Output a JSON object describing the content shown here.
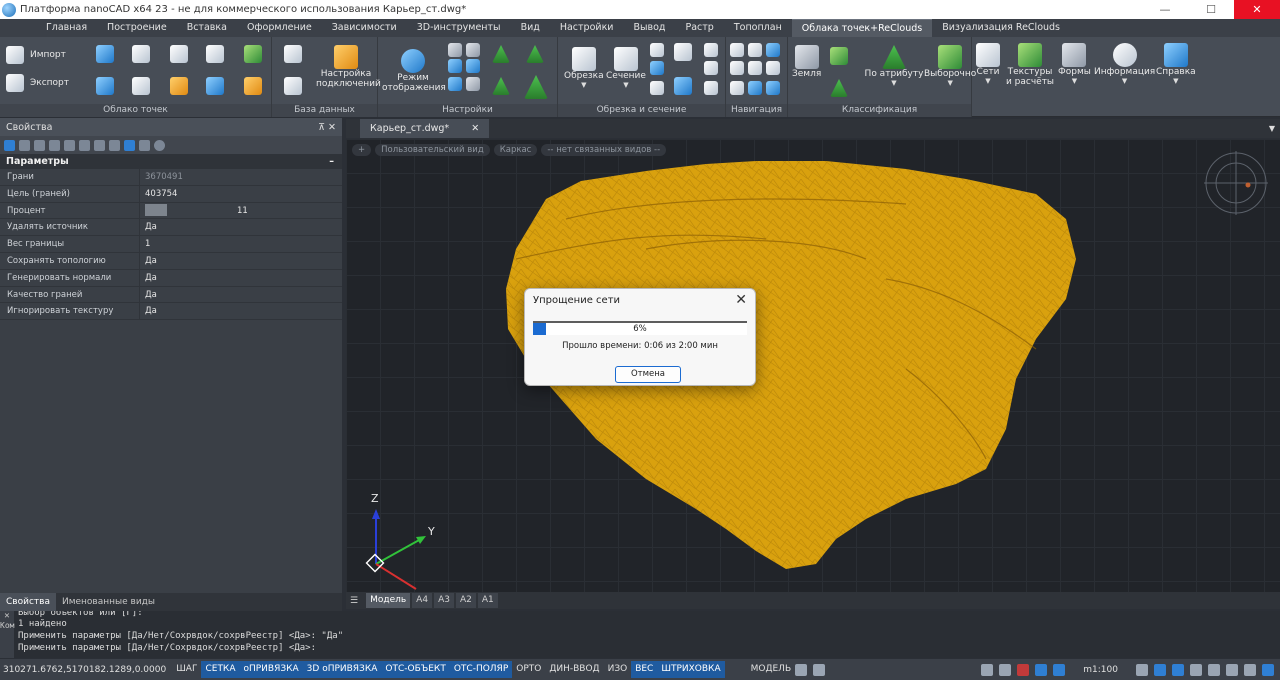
{
  "window": {
    "title": "Платформа nanoCAD x64 23 - не для коммерческого использования Карьер_ст.dwg*",
    "minimize": "—",
    "maximize": "☐",
    "close": "✕"
  },
  "ribbon_tabs": [
    "Главная",
    "Построение",
    "Вставка",
    "Оформление",
    "Зависимости",
    "3D-инструменты",
    "Вид",
    "Настройки",
    "Вывод",
    "Растр",
    "Топоплан",
    "Облака точек+ReClouds",
    "Визуализация ReClouds"
  ],
  "ribbon_active_tab": "Облака точек+ReClouds",
  "ribbon": {
    "import": "Импорт",
    "export": "Экспорт",
    "panel_cloud": "Облако точек",
    "connection_settings": "Настройка подключений",
    "panel_db": "База данных",
    "display_mode": "Режим отображения",
    "panel_settings": "Настройки",
    "clip": "Обрезка",
    "section": "Сечение",
    "panel_clip": "Обрезка и сечение",
    "panel_nav": "Навигация",
    "ground": "Земля",
    "by_attribute": "По атрибуту",
    "selective": "Выборочно",
    "panel_class": "Классификация",
    "nets": "Сети",
    "textures": "Текстуры и расчёты",
    "forms": "Формы",
    "info": "Информация",
    "help": "Справка"
  },
  "properties": {
    "header": "Свойства",
    "group": "Параметры",
    "collapse": "–",
    "rows": [
      {
        "key": "Грани",
        "value": "3670491",
        "dim": true
      },
      {
        "key": "Цель (граней)",
        "value": "403754"
      },
      {
        "key": "Процент",
        "value": "11",
        "swatch": true
      },
      {
        "key": "Удалять источник",
        "value": "Да"
      },
      {
        "key": "Вес границы",
        "value": "1"
      },
      {
        "key": "Сохранять топологию",
        "value": "Да"
      },
      {
        "key": "Генерировать нормали",
        "value": "Да"
      },
      {
        "key": "Качество граней",
        "value": "Да"
      },
      {
        "key": "Игнорировать текстуру",
        "value": "Да"
      }
    ],
    "footer_tabs": [
      "Свойства",
      "Именованные виды"
    ]
  },
  "document": {
    "tab": "Карьер_ст.dwg*",
    "close": "✕"
  },
  "viewport": {
    "controls": [
      "+",
      "Пользовательский вид",
      "Каркас",
      "-- нет связанных видов --"
    ],
    "axis_z": "Z",
    "axis_y": "Y",
    "mesh_color": "#d9a10e"
  },
  "dialog": {
    "title": "Упрощение сети",
    "progress": 6,
    "progress_label": "6%",
    "elapsed": "Прошло времени: 0:06 из 2:00 мин",
    "cancel": "Отмена"
  },
  "layout_tabs": [
    "Модель",
    "A4",
    "A3",
    "A2",
    "A1"
  ],
  "command_line": {
    "side_label": "Ком",
    "lines": [
      "Выбор объектов или [Г]:",
      "1 найдено",
      "Применить параметры [Да/Нет/Сохрвдок/сохрвРеестр] <Да>: \"Да\"",
      "Применить параметры [Да/Нет/Сохрвдок/сохрвРеестр] <Да>:"
    ]
  },
  "status": {
    "coords": "310271.6762,5170182.1289,0.0000",
    "buttons": [
      {
        "label": "ШАГ",
        "on": false
      },
      {
        "label": "СЕТКА",
        "on": true
      },
      {
        "label": "оПРИВЯЗКА",
        "on": true
      },
      {
        "label": "3D оПРИВЯЗКА",
        "on": true
      },
      {
        "label": "ОТС-ОБЪЕКТ",
        "on": true
      },
      {
        "label": "ОТС-ПОЛЯР",
        "on": true
      },
      {
        "label": "ОРТО",
        "on": false
      },
      {
        "label": "ДИН-ВВОД",
        "on": false
      },
      {
        "label": "ИЗО",
        "on": false
      },
      {
        "label": "ВЕС",
        "on": true
      },
      {
        "label": "ШТРИХОВКА",
        "on": true
      }
    ],
    "model": "МОДЕЛЬ",
    "scale": "m1:100"
  }
}
